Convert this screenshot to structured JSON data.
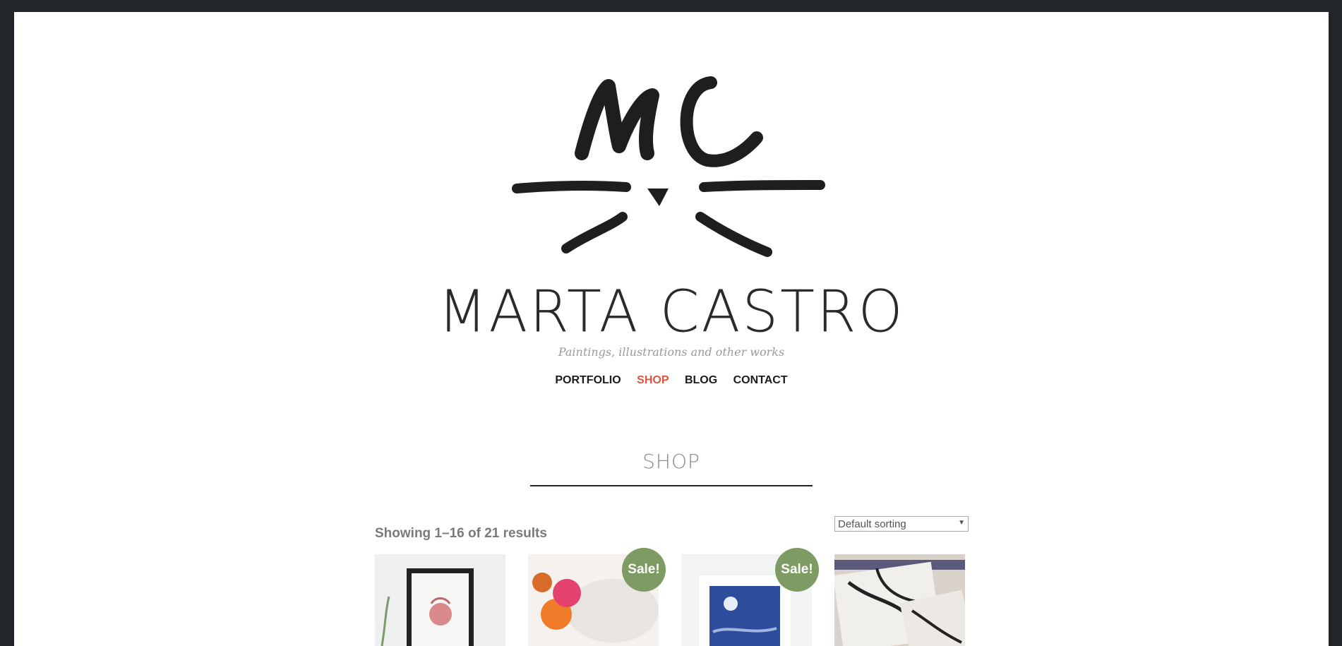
{
  "site": {
    "title": "MARTA CASTRO",
    "tagline": "Paintings, illustrations and other works",
    "logo_icon": "mc-cat-logo"
  },
  "nav": {
    "items": [
      {
        "label": "PORTFOLIO",
        "active": false
      },
      {
        "label": "SHOP",
        "active": true
      },
      {
        "label": "BLOG",
        "active": false
      },
      {
        "label": "CONTACT",
        "active": false
      }
    ],
    "active_color": "#e0533f"
  },
  "shop": {
    "heading": "SHOP",
    "results_text": "Showing 1–16 of 21 results",
    "sorting": {
      "selected": "Default sorting"
    },
    "sale_badge": "Sale!",
    "sale_color": "#7d9b63"
  },
  "products": [
    {
      "image": "framed-pink-illustration",
      "on_sale": false
    },
    {
      "image": "white-elephant-sculpture-with-flowers",
      "on_sale": true
    },
    {
      "image": "framed-blue-night-painting",
      "on_sale": true
    },
    {
      "image": "printed-pencil-cases",
      "on_sale": false
    }
  ]
}
